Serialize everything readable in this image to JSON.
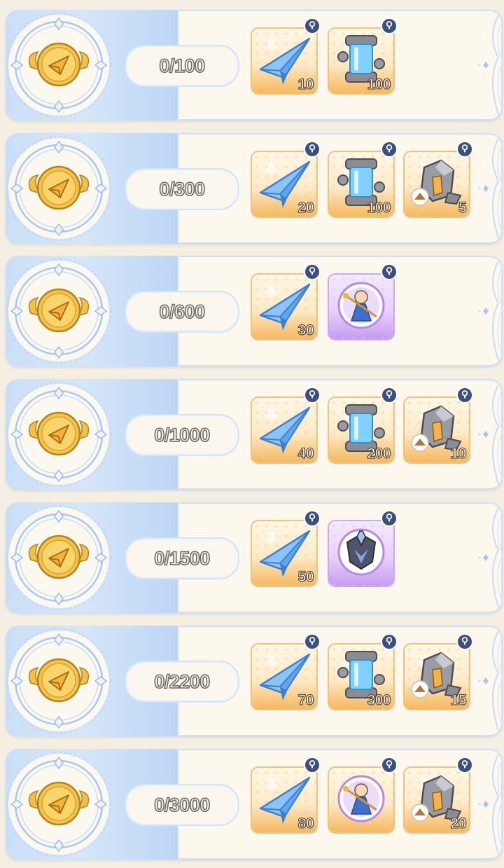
{
  "colors": {
    "panel_blue": "#cadff7",
    "card_bg": "#fcf8ee",
    "item_orange": "#f5b85e",
    "item_purple": "#c59cf2",
    "info_badge": "#3b4f80",
    "medal_gold": "#e9b93a"
  },
  "tiers": [
    {
      "progress": "0/100",
      "badge_icon": "paper-plane-medal-icon",
      "rewards": [
        {
          "icon": "paper-plane-icon",
          "frame": "orange",
          "qty": "10"
        },
        {
          "icon": "crystal-canister-icon",
          "frame": "orange",
          "qty": "100"
        }
      ]
    },
    {
      "progress": "0/300",
      "badge_icon": "paper-plane-medal-icon",
      "rewards": [
        {
          "icon": "paper-plane-icon",
          "frame": "orange",
          "qty": "20"
        },
        {
          "icon": "crystal-canister-icon",
          "frame": "orange",
          "qty": "100"
        },
        {
          "icon": "ore-stone-icon",
          "frame": "orange",
          "qty": "5"
        }
      ]
    },
    {
      "progress": "0/600",
      "badge_icon": "paper-plane-medal-icon",
      "rewards": [
        {
          "icon": "paper-plane-icon",
          "frame": "orange",
          "qty": "30"
        },
        {
          "icon": "character-portrait-icon",
          "frame": "purple",
          "qty": ""
        }
      ]
    },
    {
      "progress": "0/1000",
      "badge_icon": "paper-plane-medal-icon",
      "rewards": [
        {
          "icon": "paper-plane-icon",
          "frame": "orange",
          "qty": "40"
        },
        {
          "icon": "crystal-canister-icon",
          "frame": "orange",
          "qty": "200"
        },
        {
          "icon": "ore-stone-icon",
          "frame": "orange",
          "qty": "10"
        }
      ]
    },
    {
      "progress": "0/1500",
      "badge_icon": "paper-plane-medal-icon",
      "rewards": [
        {
          "icon": "paper-plane-icon",
          "frame": "orange",
          "qty": "50"
        },
        {
          "icon": "crystal-emblem-icon",
          "frame": "purple",
          "qty": ""
        }
      ]
    },
    {
      "progress": "0/2200",
      "badge_icon": "paper-plane-medal-icon",
      "rewards": [
        {
          "icon": "paper-plane-icon",
          "frame": "orange",
          "qty": "70"
        },
        {
          "icon": "crystal-canister-icon",
          "frame": "orange",
          "qty": "300"
        },
        {
          "icon": "ore-stone-icon",
          "frame": "orange",
          "qty": "15"
        }
      ]
    },
    {
      "progress": "0/3000",
      "badge_icon": "paper-plane-medal-icon",
      "rewards": [
        {
          "icon": "paper-plane-icon",
          "frame": "orange",
          "qty": "80"
        },
        {
          "icon": "character-portrait-icon",
          "frame": "orange",
          "qty": ""
        },
        {
          "icon": "ore-stone-icon",
          "frame": "orange",
          "qty": "20"
        }
      ]
    }
  ]
}
